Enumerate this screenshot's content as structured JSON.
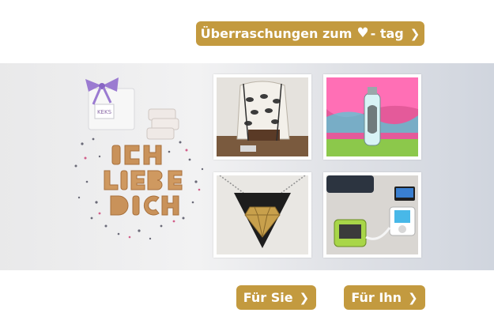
{
  "buttons": {
    "top_pre": "Überraschungen zum",
    "top_post": "- tag",
    "sie": "Für Sie",
    "ihn": "Für Ihn",
    "chevron": "❯",
    "heart": "♥"
  },
  "banner": {
    "letters": "ICH LIEBE DICH",
    "box_label": "KEKS"
  },
  "icons": {
    "chevron": "chevron-right-icon",
    "heart": "heart-icon"
  },
  "colors": {
    "button": "#c39a3f",
    "button_text": "#ffffff"
  }
}
